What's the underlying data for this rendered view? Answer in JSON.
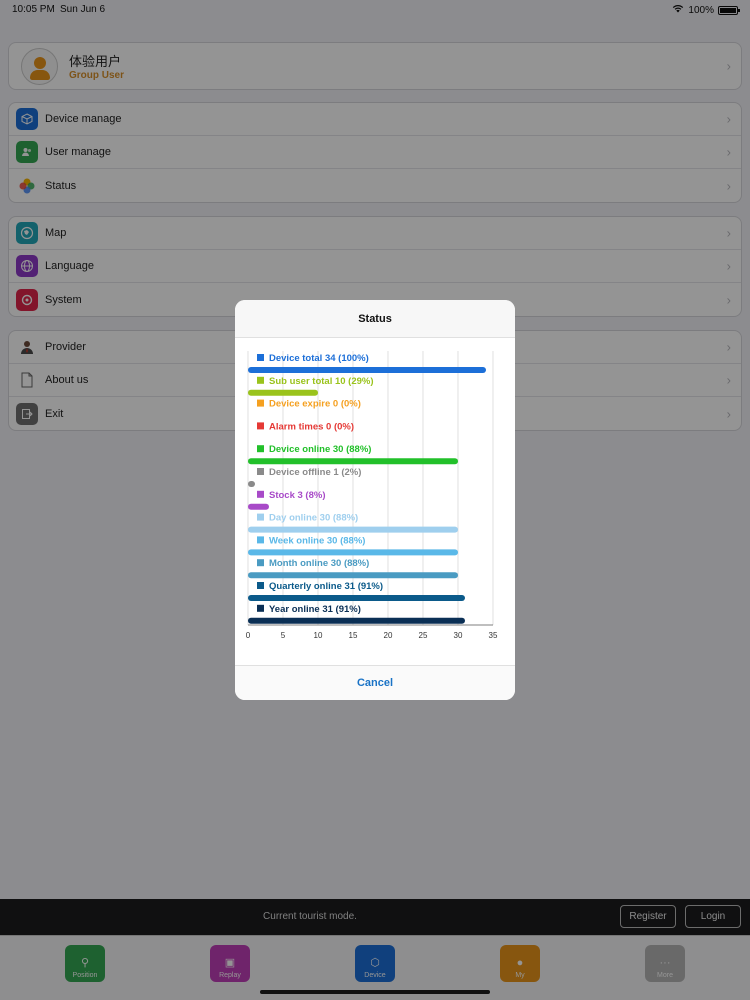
{
  "status_bar": {
    "time": "10:05 PM",
    "date": "Sun Jun 6",
    "battery": "100%"
  },
  "profile": {
    "name": "体验用户",
    "group": "Group User"
  },
  "menu_group_1": [
    {
      "label": "Device manage",
      "icon": "cube-icon",
      "color": "#1c6fd8"
    },
    {
      "label": "User manage",
      "icon": "users-icon",
      "color": "#34a853"
    },
    {
      "label": "Status",
      "icon": "pinwheel-icon",
      "color": "#ffffff"
    }
  ],
  "menu_group_2": [
    {
      "label": "Map",
      "icon": "globe-map-icon",
      "color": "#21a8b8"
    },
    {
      "label": "Language",
      "icon": "globe-icon",
      "color": "#8e3ac8"
    },
    {
      "label": "System",
      "icon": "gear-icon",
      "color": "#e0254a"
    }
  ],
  "menu_group_3": [
    {
      "label": "Provider",
      "icon": "person-tie-icon",
      "color": "#ffffff"
    },
    {
      "label": "About us",
      "icon": "document-icon",
      "color": "#ffffff"
    },
    {
      "label": "Exit",
      "icon": "exit-icon",
      "color": "#707070"
    }
  ],
  "modal": {
    "title": "Status",
    "cancel_label": "Cancel"
  },
  "tourist_bar": {
    "message": "Current tourist mode.",
    "register_label": "Register",
    "login_label": "Login"
  },
  "tabs": [
    {
      "label": "Position",
      "icon": "pin-icon",
      "color": "#34a853"
    },
    {
      "label": "Replay",
      "icon": "replay-icon",
      "color": "#c03fb8"
    },
    {
      "label": "Device",
      "icon": "cube-icon",
      "color": "#1c6fd8"
    },
    {
      "label": "My",
      "icon": "person-icon",
      "color": "#e8951a"
    },
    {
      "label": "More",
      "icon": "more-icon",
      "color": "#b5b5b5"
    }
  ],
  "chart_data": {
    "type": "bar",
    "orientation": "horizontal",
    "title": "Status",
    "xlim": [
      0,
      35
    ],
    "x_ticks": [
      0,
      5,
      10,
      15,
      20,
      25,
      30,
      35
    ],
    "grid": true,
    "series": [
      {
        "label": "Device total 34 (100%)",
        "value": 34,
        "color": "#1c6fd8"
      },
      {
        "label": "Sub user total 10 (29%)",
        "value": 10,
        "color": "#9ac31c"
      },
      {
        "label": "Device expire 0 (0%)",
        "value": 0,
        "color": "#f5a020"
      },
      {
        "label": "Alarm times 0 (0%)",
        "value": 0,
        "color": "#e53935"
      },
      {
        "label": "Device online 30 (88%)",
        "value": 30,
        "color": "#22c02a"
      },
      {
        "label": "Device offline 1 (2%)",
        "value": 1,
        "color": "#8a8a8a"
      },
      {
        "label": "Stock 3 (8%)",
        "value": 3,
        "color": "#a84ac8"
      },
      {
        "label": "Day online 30 (88%)",
        "value": 30,
        "color": "#9fcfee"
      },
      {
        "label": "Week online 30 (88%)",
        "value": 30,
        "color": "#5ab8e8"
      },
      {
        "label": "Month online 30 (88%)",
        "value": 30,
        "color": "#4a9bc2"
      },
      {
        "label": "Quarterly online 31 (91%)",
        "value": 31,
        "color": "#0b5a8a"
      },
      {
        "label": "Year online 31 (91%)",
        "value": 31,
        "color": "#0a2f55"
      }
    ]
  }
}
